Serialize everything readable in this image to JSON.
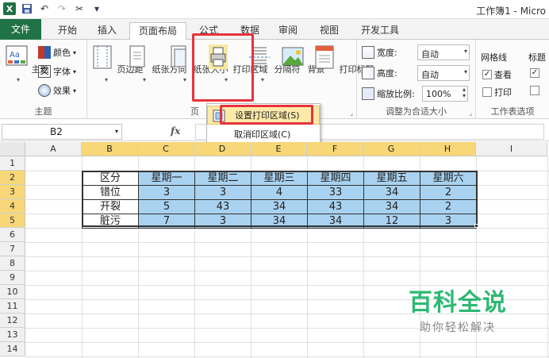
{
  "window": {
    "title": "工作簿1 - Micro"
  },
  "tabs": [
    {
      "label": "文件"
    },
    {
      "label": "开始"
    },
    {
      "label": "插入"
    },
    {
      "label": "页面布局"
    },
    {
      "label": "公式"
    },
    {
      "label": "数据"
    },
    {
      "label": "审阅"
    },
    {
      "label": "视图"
    },
    {
      "label": "开发工具"
    }
  ],
  "ribbon": {
    "theme_group": {
      "label": "主题",
      "theme_btn": "主题",
      "colors": "颜色",
      "fonts": "字体",
      "effects": "效果"
    },
    "page_setup_group": {
      "label": "页",
      "margins": "页边距",
      "orientation": "纸张方向",
      "size": "纸张大小",
      "print_area": "打印区域",
      "breaks": "分隔符",
      "background": "背景",
      "print_titles": "打印标题"
    },
    "scale_group": {
      "label": "调整为合适大小",
      "width_label": "宽度:",
      "width_value": "自动",
      "height_label": "高度:",
      "height_value": "自动",
      "scale_label": "缩放比例:",
      "scale_value": "100%"
    },
    "sheet_options_group": {
      "label": "工作表选项",
      "gridlines": "网格线",
      "view": "查看",
      "print": "打印",
      "headings": "标题"
    }
  },
  "menu": {
    "set_print_area": "设置打印区域(S)",
    "clear_print_area": "取消印区域(C)"
  },
  "formula_bar": {
    "name_box": "B2",
    "fx": "fx"
  },
  "columns": [
    "A",
    "B",
    "C",
    "D",
    "E",
    "F",
    "G",
    "H",
    "I"
  ],
  "rows": [
    "1",
    "2",
    "3",
    "4",
    "5",
    "6",
    "7",
    "8",
    "9",
    "10",
    "11",
    "12",
    "13",
    "14"
  ],
  "table": {
    "header": [
      "区分",
      "星期一",
      "星期二",
      "星期三",
      "星期四",
      "星期五",
      "星期六"
    ],
    "rows": [
      [
        "错位",
        "3",
        "3",
        "4",
        "33",
        "34",
        "2"
      ],
      [
        "开裂",
        "5",
        "43",
        "34",
        "43",
        "34",
        "2"
      ],
      [
        "脏污",
        "7",
        "3",
        "34",
        "34",
        "12",
        "3"
      ]
    ]
  },
  "watermark": {
    "main": "百科全说",
    "sub": "助你轻松解决"
  }
}
